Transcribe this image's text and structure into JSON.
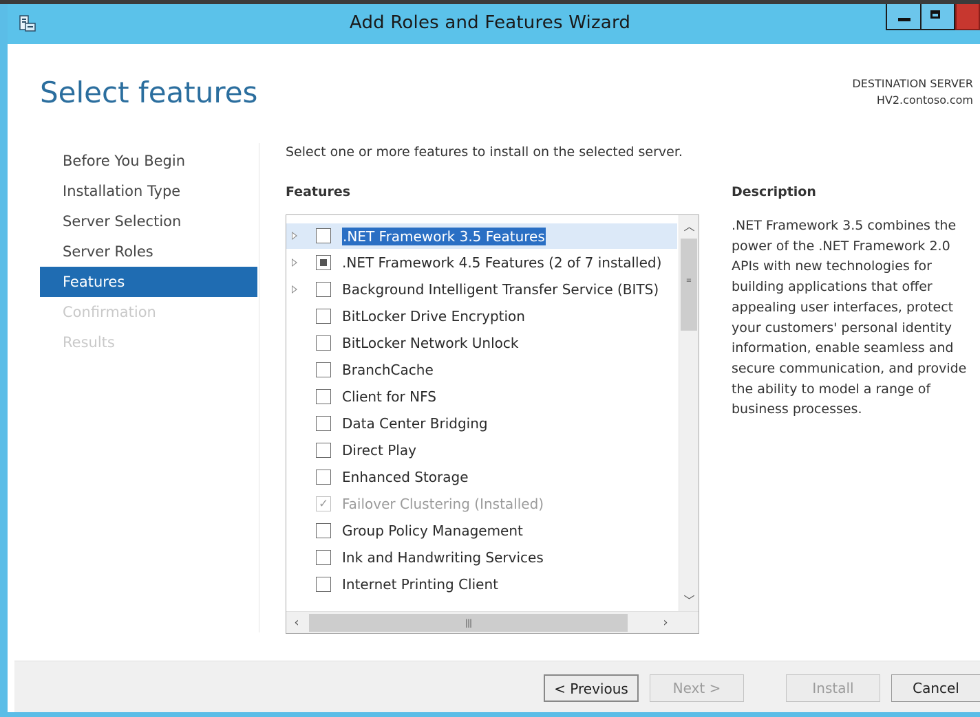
{
  "window": {
    "title": "Add Roles and Features Wizard",
    "app_icon": "server-manager-icon",
    "controls": {
      "minimize": "minimize-icon",
      "maximize": "maximize-icon",
      "close": "close-icon"
    },
    "accent_color": "#5bc2ea"
  },
  "page": {
    "title": "Select features",
    "destination_label": "DESTINATION SERVER",
    "destination_server": "HV2.contoso.com"
  },
  "nav": {
    "items": [
      {
        "label": "Before You Begin",
        "state": "normal"
      },
      {
        "label": "Installation Type",
        "state": "normal"
      },
      {
        "label": "Server Selection",
        "state": "normal"
      },
      {
        "label": "Server Roles",
        "state": "normal"
      },
      {
        "label": "Features",
        "state": "active"
      },
      {
        "label": "Confirmation",
        "state": "disabled"
      },
      {
        "label": "Results",
        "state": "disabled"
      }
    ],
    "active_color": "#1f6cb2"
  },
  "main": {
    "instruction": "Select one or more features to install on the selected server.",
    "features_heading": "Features",
    "features": [
      {
        "label": ".NET Framework 3.5 Features",
        "expandable": true,
        "checkbox": "unchecked",
        "selected": true
      },
      {
        "label": ".NET Framework 4.5 Features (2 of 7 installed)",
        "expandable": true,
        "checkbox": "partial"
      },
      {
        "label": "Background Intelligent Transfer Service (BITS)",
        "expandable": true,
        "checkbox": "unchecked"
      },
      {
        "label": "BitLocker Drive Encryption",
        "checkbox": "unchecked"
      },
      {
        "label": "BitLocker Network Unlock",
        "checkbox": "unchecked"
      },
      {
        "label": "BranchCache",
        "checkbox": "unchecked"
      },
      {
        "label": "Client for NFS",
        "checkbox": "unchecked"
      },
      {
        "label": "Data Center Bridging",
        "checkbox": "unchecked"
      },
      {
        "label": "Direct Play",
        "checkbox": "unchecked"
      },
      {
        "label": "Enhanced Storage",
        "checkbox": "unchecked"
      },
      {
        "label": "Failover Clustering (Installed)",
        "checkbox": "checked-disabled"
      },
      {
        "label": "Group Policy Management",
        "checkbox": "unchecked"
      },
      {
        "label": "Ink and Handwriting Services",
        "checkbox": "unchecked"
      },
      {
        "label": "Internet Printing Client",
        "checkbox": "unchecked"
      }
    ],
    "description_heading": "Description",
    "description": ".NET Framework 3.5 combines the power of the .NET Framework 2.0 APIs with new technologies for building applications that offer appealing user interfaces, protect your customers' personal identity information, enable seamless and secure communication, and provide the ability to model a range of business processes."
  },
  "footer": {
    "previous": "< Previous",
    "next": "Next >",
    "install": "Install",
    "cancel": "Cancel"
  }
}
